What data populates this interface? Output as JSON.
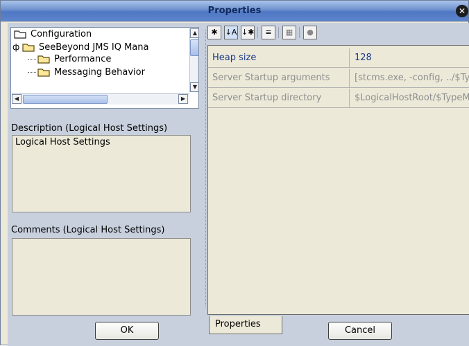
{
  "window": {
    "title": "Properties"
  },
  "tree": {
    "items": [
      {
        "label": "Configuration",
        "level": 0
      },
      {
        "label": "SeeBeyond JMS IQ Mana",
        "level": 1
      },
      {
        "label": "Performance",
        "level": 2
      },
      {
        "label": "Messaging Behavior",
        "level": 2
      }
    ]
  },
  "description": {
    "label": "Description (Logical Host Settings)",
    "text": "Logical Host Settings"
  },
  "comments": {
    "label": "Comments (Logical Host Settings)",
    "text": ""
  },
  "toolbar": {
    "buttons": [
      "sort-icon",
      "sort-az-icon",
      "categorize-icon",
      "edit-list-icon",
      "grid-icon",
      "help-icon"
    ]
  },
  "properties": {
    "rows": [
      {
        "name": "Heap size",
        "value": "128",
        "state": "active"
      },
      {
        "name": "Server Startup arguments",
        "value": "[stcms.exe, -config, ../$Ty",
        "state": "disabled"
      },
      {
        "name": "Server Startup directory",
        "value": "$LogicalHostRoot/$TypeM",
        "state": "disabled"
      }
    ],
    "tab_label": "Properties"
  },
  "buttons": {
    "ok": "OK",
    "cancel": "Cancel"
  },
  "colors": {
    "title_bar": "#5d84cc",
    "panel_bg": "#c8d0dd",
    "active_text": "#1b3a8a",
    "disabled_text": "#8f8f8f"
  }
}
